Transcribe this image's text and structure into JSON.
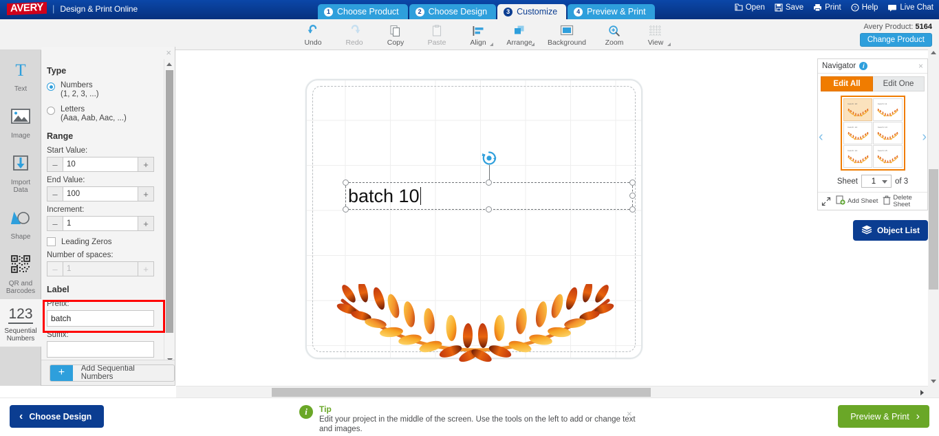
{
  "app": {
    "brand": "AVERY",
    "brand_separator": "|",
    "subtitle": "Design & Print Online"
  },
  "steps": [
    {
      "num": "1",
      "label": "Choose Product",
      "active": false
    },
    {
      "num": "2",
      "label": "Choose Design",
      "active": false
    },
    {
      "num": "3",
      "label": "Customize",
      "active": true
    },
    {
      "num": "4",
      "label": "Preview & Print",
      "active": false
    }
  ],
  "utility": [
    {
      "label": "Open",
      "icon": "folder-open-icon"
    },
    {
      "label": "Save",
      "icon": "floppy-disk-icon"
    },
    {
      "label": "Print",
      "icon": "printer-icon"
    },
    {
      "label": "Help",
      "icon": "question-circle-icon"
    },
    {
      "label": "Live Chat",
      "icon": "chat-bubble-icon"
    }
  ],
  "toolbar": {
    "tools": [
      {
        "label": "Undo",
        "icon": "undo-arrow-icon",
        "disabled": false,
        "caret": false
      },
      {
        "label": "Redo",
        "icon": "redo-arrow-icon",
        "disabled": true,
        "caret": false
      },
      {
        "label": "Copy",
        "icon": "copy-pages-icon",
        "disabled": false,
        "caret": false
      },
      {
        "label": "Paste",
        "icon": "paste-clipboard-icon",
        "disabled": true,
        "caret": false
      },
      {
        "label": "Align",
        "icon": "align-left-icon",
        "disabled": false,
        "caret": true
      },
      {
        "label": "Arrange",
        "icon": "arrange-layers-icon",
        "disabled": false,
        "caret": true
      },
      {
        "label": "Background",
        "icon": "background-square-icon",
        "disabled": false,
        "caret": false
      },
      {
        "label": "Zoom",
        "icon": "magnifier-plus-icon",
        "disabled": false,
        "caret": false
      },
      {
        "label": "View",
        "icon": "grid-view-icon",
        "disabled": false,
        "caret": true
      }
    ],
    "product_label": "Avery Product:",
    "product_number": "5164",
    "change_product_label": "Change Product"
  },
  "rail": {
    "items": [
      {
        "label": "Text",
        "icon": "text-t-icon",
        "active": false
      },
      {
        "label": "Image",
        "icon": "image-picture-icon",
        "active": false
      },
      {
        "label": "Import\nData",
        "label_line1": "Import",
        "label_line2": "Data",
        "icon": "import-data-arrow-icon",
        "active": false
      },
      {
        "label": "Shape",
        "icon": "shape-triangle-circle-icon",
        "active": false
      },
      {
        "label": "QR and Barcodes",
        "label_line1": "QR and",
        "label_line2": "Barcodes",
        "icon": "qr-code-icon",
        "active": false
      },
      {
        "label": "Sequential Numbers",
        "label_line1": "Sequential",
        "label_line2": "Numbers",
        "icon": "sequential-numbers-123-icon",
        "active": true,
        "glyph": "123"
      }
    ]
  },
  "panel": {
    "close_label": "×",
    "type_heading": "Type",
    "type_options": [
      {
        "line1": "Numbers",
        "line2": "(1, 2, 3, ...)",
        "checked": true
      },
      {
        "line1": "Letters",
        "line2": "(Aaa, Aab, Aac, ...)",
        "checked": false
      }
    ],
    "range_heading": "Range",
    "start_value_label": "Start Value:",
    "start_value": "10",
    "end_value_label": "End Value:",
    "end_value": "100",
    "increment_label": "Increment:",
    "increment_value": "1",
    "leading_zeros_label": "Leading Zeros",
    "leading_zeros_checked": false,
    "number_of_spaces_label": "Number of spaces:",
    "number_of_spaces_value": "1",
    "label_heading": "Label",
    "prefix_label": "Prefix:",
    "prefix_value": "batch",
    "suffix_label": "Suffix:",
    "suffix_value": "",
    "minus_glyph": "–",
    "plus_glyph": "+",
    "add_button_label": "Add Sequential Numbers",
    "add_button_plus": "+",
    "highlight_color": "#ff0000"
  },
  "canvas": {
    "text_object": {
      "value": "batch 10",
      "has_cursor": true
    }
  },
  "navigator": {
    "title": "Navigator",
    "info_glyph": "i",
    "close_glyph": "×",
    "tab_edit_all": "Edit All",
    "tab_edit_one": "Edit One",
    "active_tab": "Edit All",
    "prev_arrow": "‹",
    "next_arrow": "›",
    "thumbnails": [
      {
        "text": "batch 10",
        "selected": true
      },
      {
        "text": "batch 11",
        "selected": false
      },
      {
        "text": "batch 12",
        "selected": false
      },
      {
        "text": "batch 13",
        "selected": false
      },
      {
        "text": "batch 14",
        "selected": false
      },
      {
        "text": "batch 15",
        "selected": false
      }
    ],
    "sheet_label": "Sheet",
    "sheet_value": "1",
    "sheet_of": "of 3",
    "add_sheet_label": "Add Sheet",
    "delete_sheet_label_1": "Delete",
    "delete_sheet_label_2": "Sheet",
    "expand_icon": "expand-arrows-icon",
    "object_list_label": "Object List"
  },
  "bottom": {
    "choose_design_label": "Choose Design",
    "choose_design_chevron": "‹",
    "preview_print_label": "Preview & Print",
    "preview_print_chevron": "›",
    "tip_title": "Tip",
    "tip_text": "Edit your project in the middle of the screen. Use the tools on the left to add or change text and images.",
    "tip_close": "×"
  },
  "colors": {
    "brand_blue": "#0b3d91",
    "accent_blue": "#2e9fdc",
    "orange": "#f07c00",
    "green": "#6aa727",
    "red_highlight": "#ff0000",
    "avery_red": "#d0021b"
  }
}
